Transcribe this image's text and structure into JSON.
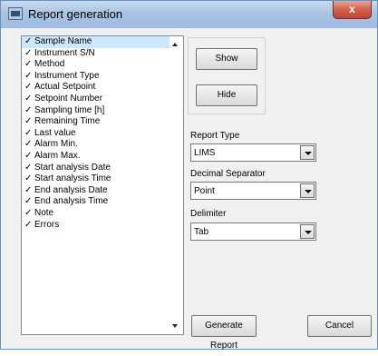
{
  "window": {
    "title": "Report generation",
    "close_glyph": "x",
    "icon": "app-report-icon"
  },
  "fields": [
    {
      "label": "Sample Name",
      "selected": true
    },
    {
      "label": "Instrument S/N"
    },
    {
      "label": "Method"
    },
    {
      "label": "Instrument Type"
    },
    {
      "label": "Actual Setpoint"
    },
    {
      "label": "Setpoint Number"
    },
    {
      "label": "Sampling  time [h]"
    },
    {
      "label": "Remaining Time"
    },
    {
      "label": "Last  value"
    },
    {
      "label": "Alarm Min."
    },
    {
      "label": "Alarm Max."
    },
    {
      "label": "Start analysis Date"
    },
    {
      "label": "Start analysis Time"
    },
    {
      "label": "End analysis Date"
    },
    {
      "label": "End analysis Time"
    },
    {
      "label": "Note"
    },
    {
      "label": "Errors"
    }
  ],
  "check_mark": "✓",
  "buttons": {
    "show": "Show",
    "hide": "Hide",
    "generate": "Generate Report",
    "cancel": "Cancel"
  },
  "report_type": {
    "label": "Report Type",
    "value": "LIMS"
  },
  "decimal_separator": {
    "label": "Decimal Separator",
    "value": "Point"
  },
  "delimiter": {
    "label": "Delimiter",
    "value": "Tab"
  },
  "colors": {
    "selection": "#cce8ff",
    "title_gradient": "#a9c4e3",
    "close": "#c4432c"
  }
}
